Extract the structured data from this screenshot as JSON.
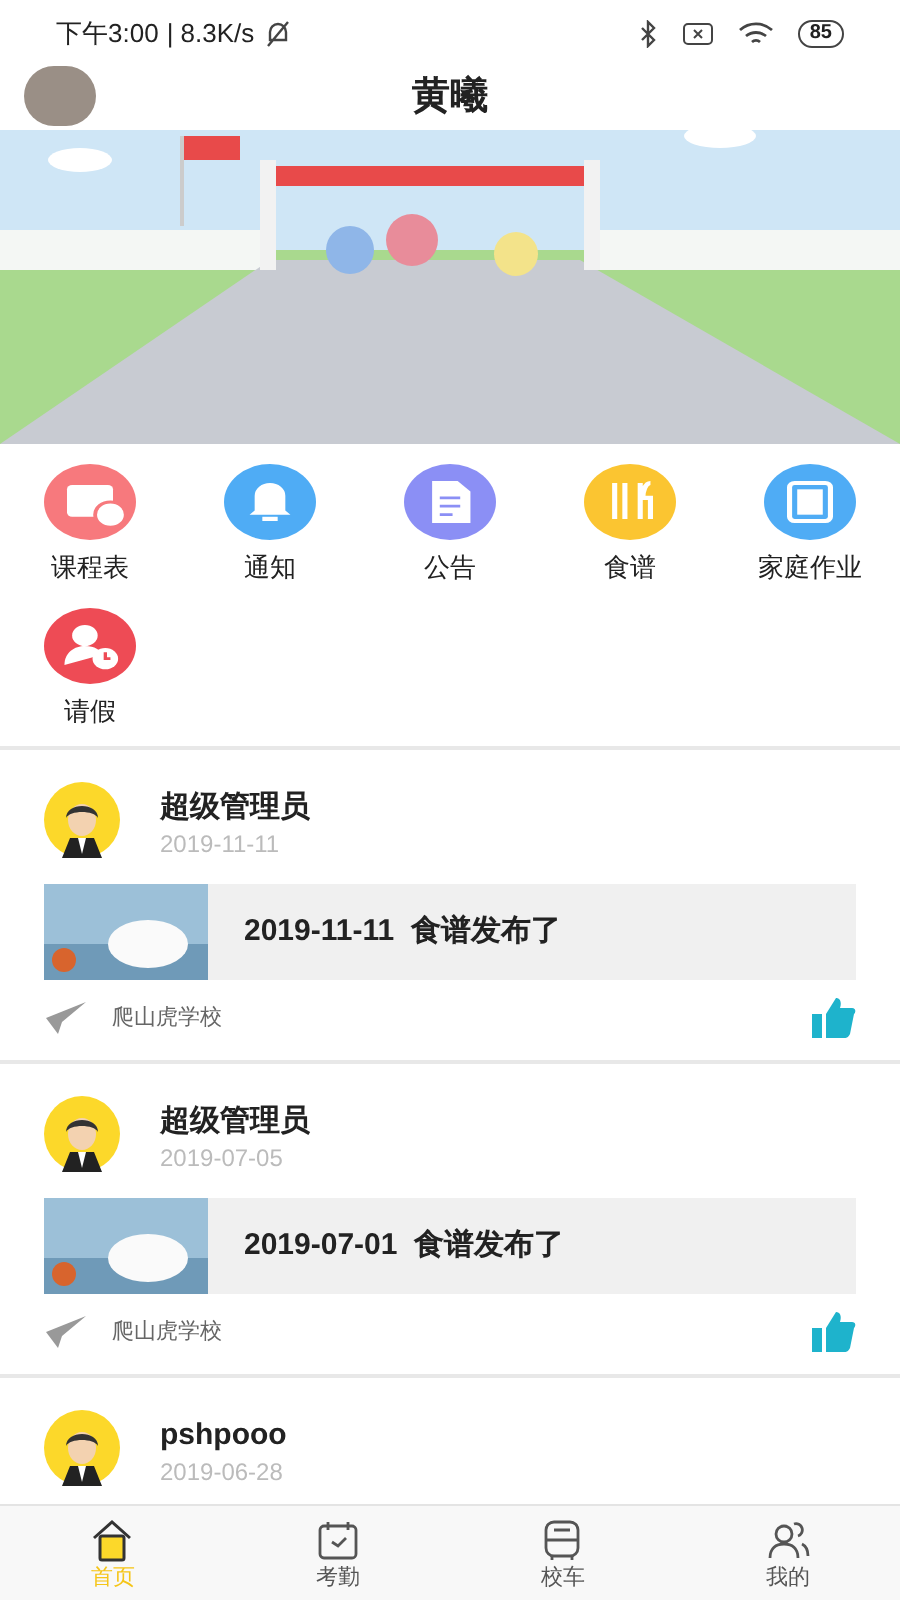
{
  "status_bar": {
    "time": "下午3:00",
    "speed": "| 8.3K/s",
    "battery": "85"
  },
  "header": {
    "title": "黄曦"
  },
  "shortcuts": [
    {
      "label": "课程表",
      "kind": "timetable",
      "color": "#f7797d"
    },
    {
      "label": "通知",
      "kind": "notice",
      "color": "#4facf5"
    },
    {
      "label": "公告",
      "kind": "bulletin",
      "color": "#8b8ff5"
    },
    {
      "label": "食谱",
      "kind": "menu",
      "color": "#fbc531"
    },
    {
      "label": "家庭作业",
      "kind": "homework",
      "color": "#4facf5"
    },
    {
      "label": "请假",
      "kind": "leave",
      "color": "#ee4b55"
    }
  ],
  "posts": [
    {
      "author": "超级管理员",
      "date": "2019-11-11",
      "title": "2019-11-11  食谱发布了",
      "school": "爬山虎学校"
    },
    {
      "author": "超级管理员",
      "date": "2019-07-05",
      "title": "2019-07-01  食谱发布了",
      "school": "爬山虎学校"
    },
    {
      "author": "pshpooo",
      "date": "2019-06-28"
    }
  ],
  "tabs": [
    {
      "label": "首页",
      "kind": "home",
      "selected": true
    },
    {
      "label": "考勤",
      "kind": "attendance",
      "selected": false
    },
    {
      "label": "校车",
      "kind": "bus",
      "selected": false
    },
    {
      "label": "我的",
      "kind": "profile",
      "selected": false
    }
  ]
}
